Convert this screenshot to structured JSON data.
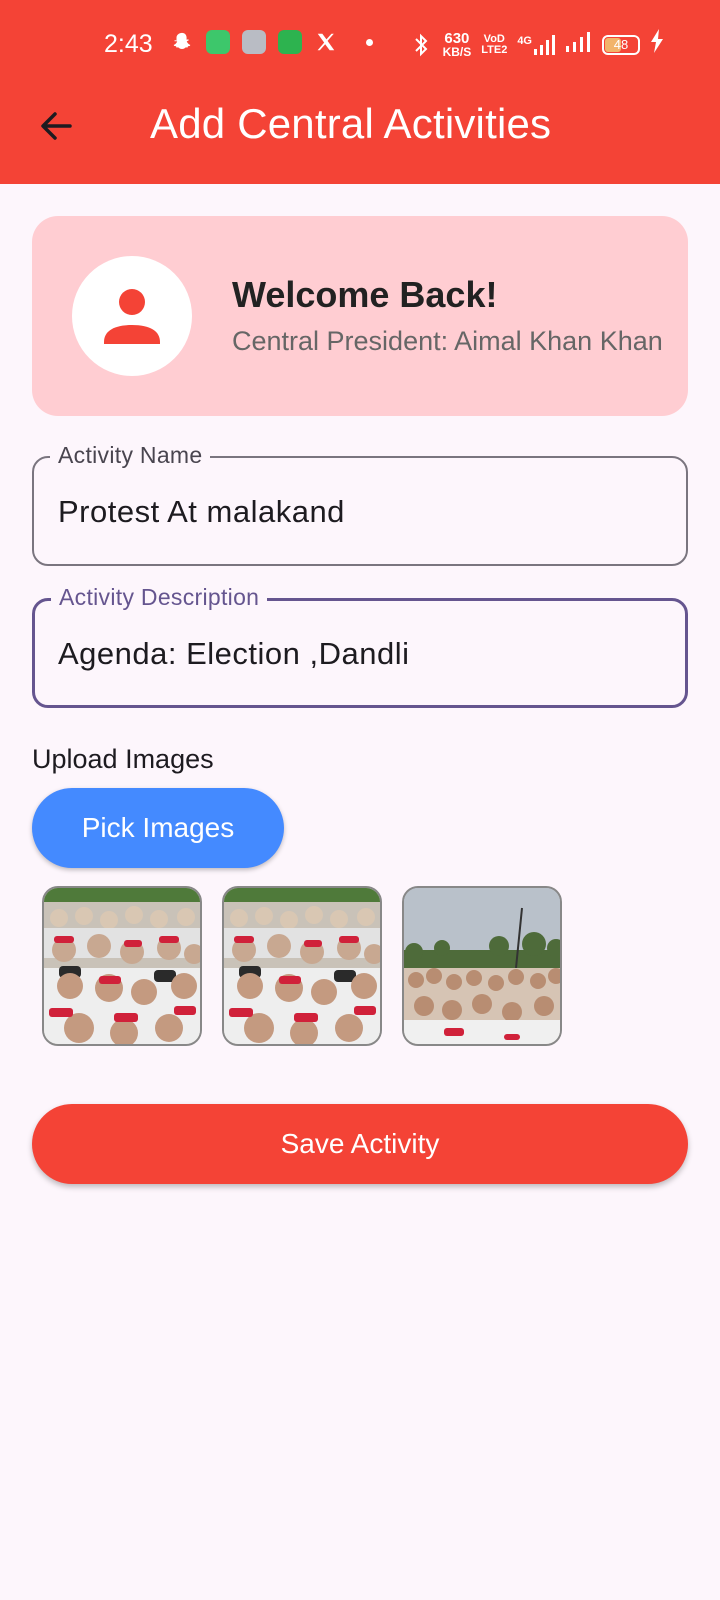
{
  "status_bar": {
    "time": "2:43",
    "net_speed_value": "630",
    "net_speed_unit": "KB/S",
    "volte_top": "VoD",
    "volte_bottom": "LTE2",
    "network_type": "4G",
    "battery_level": "48"
  },
  "app_bar": {
    "title": "Add Central Activities"
  },
  "welcome": {
    "title": "Welcome Back!",
    "subtitle": "Central President: Aimal Khan Khan"
  },
  "form": {
    "activity_name_label": "Activity Name",
    "activity_name_value": "Protest At malakand",
    "activity_description_label": "Activity Description",
    "activity_description_value": "Agenda: Election ,Dandli",
    "upload_label": "Upload Images",
    "pick_images_label": "Pick Images",
    "save_label": "Save Activity"
  },
  "colors": {
    "app_bar": "#F44336",
    "card": "#FFCDD2",
    "pick_button": "#448AFF",
    "save_button": "#F44336",
    "focused_field": "#65558F",
    "background": "#FDF6FC"
  },
  "icons": [
    "back-arrow-icon",
    "person-icon"
  ]
}
